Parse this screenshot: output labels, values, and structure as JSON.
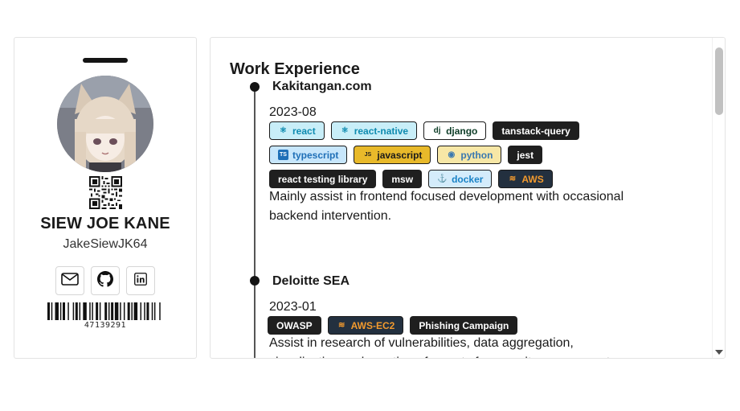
{
  "profile": {
    "name": "SIEW JOE KANE",
    "handle": "JakeSiewJK64",
    "barcode_number": "47139291",
    "socials": [
      {
        "icon": "mail-icon"
      },
      {
        "icon": "github-icon"
      },
      {
        "icon": "linkedin-icon"
      }
    ]
  },
  "experience": {
    "title": "Work Experience",
    "items": [
      {
        "company": "Kakitangan.com",
        "date": "2023-08",
        "tags": [
          {
            "label": "react",
            "icon": "react-icon",
            "style": "react"
          },
          {
            "label": "react-native",
            "icon": "react-icon",
            "style": "react"
          },
          {
            "label": "django",
            "icon": "django-icon",
            "style": "django"
          },
          {
            "label": "tanstack-query",
            "icon": "",
            "style": "dark"
          },
          {
            "label": "typescript",
            "icon": "typescript-icon",
            "style": "ts"
          },
          {
            "label": "javascript",
            "icon": "javascript-icon",
            "style": "js"
          },
          {
            "label": "python",
            "icon": "python-icon",
            "style": "py"
          },
          {
            "label": "jest",
            "icon": "",
            "style": "dark"
          },
          {
            "label": "react testing library",
            "icon": "",
            "style": "dark"
          },
          {
            "label": "msw",
            "icon": "",
            "style": "dark"
          },
          {
            "label": "docker",
            "icon": "docker-icon",
            "style": "docker"
          },
          {
            "label": "AWS",
            "icon": "aws-icon",
            "style": "aws"
          }
        ],
        "description": "Mainly assist in frontend focused development with occasional backend intervention."
      },
      {
        "company": "Deloitte SEA",
        "date": "2023-01",
        "tags": [
          {
            "label": "OWASP",
            "icon": "",
            "style": "dark"
          },
          {
            "label": "AWS-EC2",
            "icon": "aws-icon",
            "style": "aws"
          },
          {
            "label": "Phishing Campaign",
            "icon": "",
            "style": "dark"
          }
        ],
        "description": "Assist in research of vulnerabilities, data aggregation, visualization and creation of reports for security assessment."
      }
    ]
  },
  "colors": {
    "accent_dark": "#1f1f1f",
    "react": "#0e8bb0",
    "aws_orange": "#f29a2e"
  }
}
